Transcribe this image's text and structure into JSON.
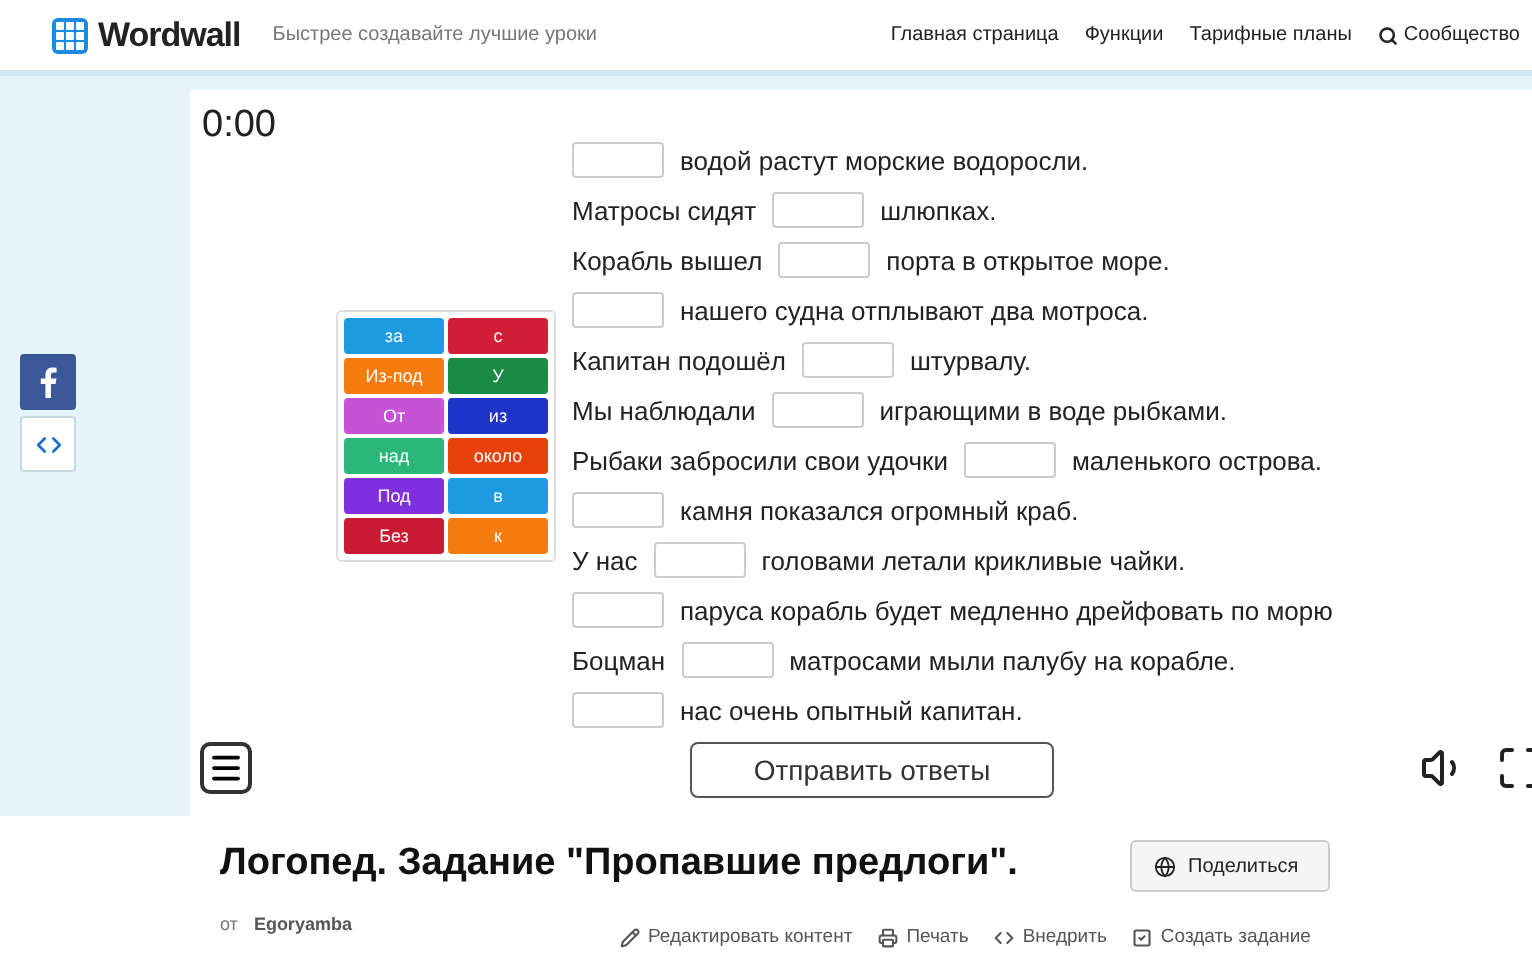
{
  "header": {
    "logo": "Wordwall",
    "tagline": "Быстрее создавайте лучшие уроки",
    "nav": [
      "Главная страница",
      "Функции",
      "Тарифные планы",
      "Сообщество"
    ]
  },
  "game": {
    "timer": "0:00",
    "tiles": [
      {
        "label": "за",
        "color": "#1e9be0"
      },
      {
        "label": "с",
        "color": "#d11d35"
      },
      {
        "label": "Из-под",
        "color": "#f57b0f"
      },
      {
        "label": "У",
        "color": "#1a8a45"
      },
      {
        "label": "От",
        "color": "#c653d6"
      },
      {
        "label": "из",
        "color": "#1f33c9"
      },
      {
        "label": "над",
        "color": "#2bb77a"
      },
      {
        "label": "около",
        "color": "#e8420a"
      },
      {
        "label": "Под",
        "color": "#7f2ee0"
      },
      {
        "label": "в",
        "color": "#1e9be0"
      },
      {
        "label": "Без",
        "color": "#c91a33"
      },
      {
        "label": "к",
        "color": "#f57b0f"
      }
    ],
    "sentences": [
      {
        "after": "водой растут морские водоросли."
      },
      {
        "before": "Матросы сидят",
        "after": "шлюпках."
      },
      {
        "before": "Корабль вышел",
        "after": "порта в открытое море."
      },
      {
        "after": "нашего судна отплывают два мотроса."
      },
      {
        "before": "Капитан подошёл",
        "after": "штурвалу."
      },
      {
        "before": "Мы наблюдали",
        "after": "играющими в воде рыбками."
      },
      {
        "before": "Рыбаки забросили свои удочки",
        "after": "маленького острова."
      },
      {
        "after": "камня показался огромный краб."
      },
      {
        "before": "У нас",
        "after": "головами летали крикливые чайки."
      },
      {
        "after": "паруса корабль будет медленно дрейфовать по морю"
      },
      {
        "before": "Боцман",
        "after": "матросами мыли палубу на корабле."
      },
      {
        "after": "нас очень опытный капитан."
      }
    ],
    "submit": "Отправить ответы"
  },
  "info": {
    "title": "Логопед. Задание \"Пропавшие предлоги\".",
    "by": "от",
    "author": "Egoryamba",
    "share": "Поделиться",
    "actions": [
      {
        "kind": "edit",
        "label": "Редактировать контент"
      },
      {
        "kind": "print",
        "label": "Печать"
      },
      {
        "kind": "embed",
        "label": "Внедрить"
      },
      {
        "kind": "create",
        "label": "Создать задание"
      }
    ]
  }
}
